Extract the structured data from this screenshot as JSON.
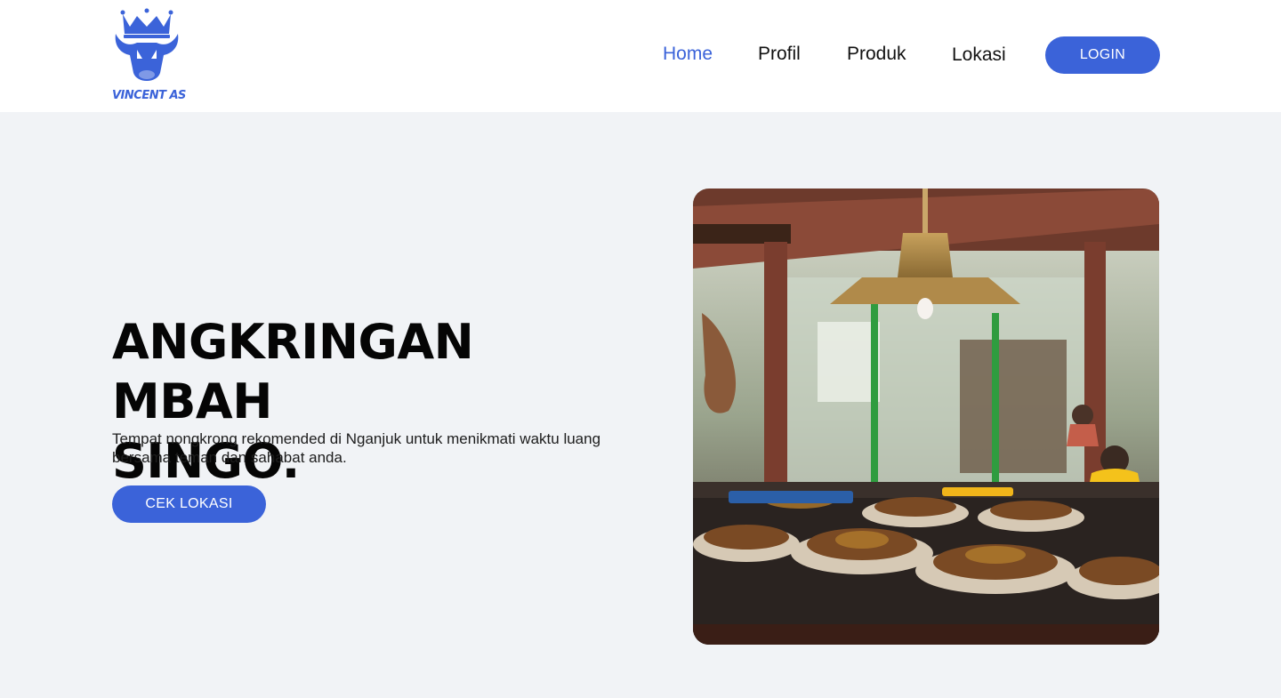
{
  "brand": {
    "name": "VINCENT AS",
    "logo_icon": "crowned-bull-head-icon",
    "color": "#3b63d9"
  },
  "nav": {
    "items": [
      {
        "label": "Home",
        "active": true
      },
      {
        "label": "Profil",
        "active": false
      },
      {
        "label": "Produk",
        "active": false
      },
      {
        "label": "Lokasi",
        "active": false
      }
    ],
    "login_label": "LOGIN"
  },
  "hero": {
    "title_line1": "ANGKRINGAN MBAH",
    "title_line2": "SINGO.",
    "description": "Tempat nongkrong rekomended di Nganjuk untuk menikmati waktu luang bersama teman dan sahabat anda.",
    "cta_label": "CEK LOKASI",
    "image": "angkringan-food-stall-photo"
  },
  "colors": {
    "accent": "#3b63d9",
    "hero_background": "#f1f3f6",
    "header_background": "#ffffff"
  }
}
